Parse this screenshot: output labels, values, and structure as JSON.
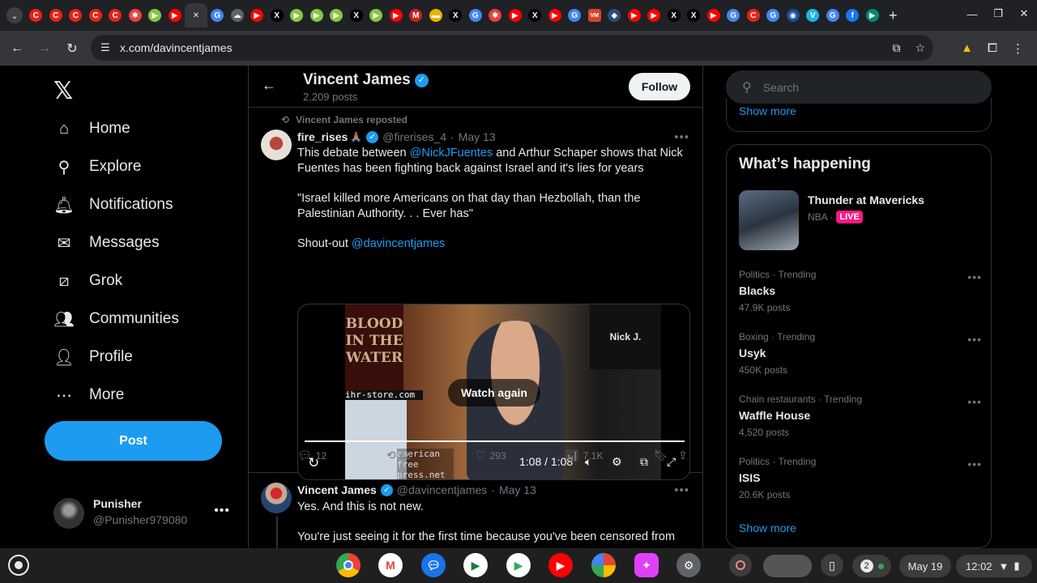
{
  "browser": {
    "url": "x.com/davincentjames",
    "tabs": [
      {
        "icon": "youtube-icon",
        "color": "#e62117",
        "glyph": "C"
      },
      {
        "icon": "youtube-icon",
        "color": "#e62117",
        "glyph": "C"
      },
      {
        "icon": "youtube-icon",
        "color": "#e62117",
        "glyph": "C"
      },
      {
        "icon": "youtube-icon",
        "color": "#e62117",
        "glyph": "C"
      },
      {
        "icon": "youtube-icon",
        "color": "#e62117",
        "glyph": "C"
      },
      {
        "icon": "app-icon",
        "color": "#e8403a",
        "glyph": "✱"
      },
      {
        "icon": "rumble-icon",
        "color": "#85c742",
        "glyph": "▶"
      },
      {
        "icon": "youtube-icon",
        "color": "#ff0000",
        "glyph": "▶"
      },
      {
        "icon": "close-icon",
        "color": "#35363a",
        "glyph": "✕",
        "active": true
      },
      {
        "icon": "google-icon",
        "color": "#4285f4",
        "glyph": "G"
      },
      {
        "icon": "cloud-icon",
        "color": "#5f6368",
        "glyph": "☁"
      },
      {
        "icon": "youtube-icon",
        "color": "#ff0000",
        "glyph": "▶"
      },
      {
        "icon": "x-icon",
        "color": "#000000",
        "glyph": "X"
      },
      {
        "icon": "rumble-icon",
        "color": "#85c742",
        "glyph": "▶"
      },
      {
        "icon": "rumble-icon",
        "color": "#85c742",
        "glyph": "▶"
      },
      {
        "icon": "rumble-icon",
        "color": "#85c742",
        "glyph": "▶"
      },
      {
        "icon": "x-icon",
        "color": "#000000",
        "glyph": "X"
      },
      {
        "icon": "rumble-icon",
        "color": "#85c742",
        "glyph": "▶"
      },
      {
        "icon": "youtube-icon",
        "color": "#ff0000",
        "glyph": "▶"
      },
      {
        "icon": "gmail-icon",
        "color": "#c5221f",
        "glyph": "M"
      },
      {
        "icon": "flag-icon",
        "color": "#e8b400",
        "glyph": "▬"
      },
      {
        "icon": "x-icon",
        "color": "#000000",
        "glyph": "X"
      },
      {
        "icon": "google-icon",
        "color": "#4285f4",
        "glyph": "G"
      },
      {
        "icon": "app-icon",
        "color": "#e8403a",
        "glyph": "✱"
      },
      {
        "icon": "youtube-icon",
        "color": "#ff0000",
        "glyph": "▶"
      },
      {
        "icon": "x-icon",
        "color": "#000000",
        "glyph": "X"
      },
      {
        "icon": "youtube-icon",
        "color": "#ff0000",
        "glyph": "▶"
      },
      {
        "icon": "google-icon",
        "color": "#4285f4",
        "glyph": "G"
      },
      {
        "icon": "vm-icon",
        "color": "#d2462a",
        "glyph": "VM"
      },
      {
        "icon": "site-icon",
        "color": "#2b4c7e",
        "glyph": "◆"
      },
      {
        "icon": "youtube-icon",
        "color": "#ff0000",
        "glyph": "▶"
      },
      {
        "icon": "youtube-icon",
        "color": "#ff0000",
        "glyph": "▶"
      },
      {
        "icon": "x-icon",
        "color": "#000000",
        "glyph": "X"
      },
      {
        "icon": "x-icon",
        "color": "#000000",
        "glyph": "X"
      },
      {
        "icon": "youtube-icon",
        "color": "#ff0000",
        "glyph": "▶"
      },
      {
        "icon": "google-icon",
        "color": "#4285f4",
        "glyph": "G"
      },
      {
        "icon": "youtube-icon",
        "color": "#e62117",
        "glyph": "C"
      },
      {
        "icon": "google-icon",
        "color": "#4285f4",
        "glyph": "G"
      },
      {
        "icon": "site-icon",
        "color": "#1a4d9c",
        "glyph": "◉"
      },
      {
        "icon": "vimeo-icon",
        "color": "#1ab7ea",
        "glyph": "V"
      },
      {
        "icon": "google-icon",
        "color": "#4285f4",
        "glyph": "G"
      },
      {
        "icon": "facebook-icon",
        "color": "#1877f2",
        "glyph": "f"
      },
      {
        "icon": "meet-icon",
        "color": "#00897b",
        "glyph": "▶"
      }
    ]
  },
  "nav": {
    "items": [
      {
        "label": "Home",
        "icon": "home-icon",
        "glyph": "⌂"
      },
      {
        "label": "Explore",
        "icon": "search-icon",
        "glyph": "⚲"
      },
      {
        "label": "Notifications",
        "icon": "bell-icon",
        "glyph": "🔔︎"
      },
      {
        "label": "Messages",
        "icon": "mail-icon",
        "glyph": "✉"
      },
      {
        "label": "Grok",
        "icon": "grok-icon",
        "glyph": "⧄"
      },
      {
        "label": "Communities",
        "icon": "communities-icon",
        "glyph": "👥︎"
      },
      {
        "label": "Profile",
        "icon": "person-icon",
        "glyph": "👤︎"
      },
      {
        "label": "More",
        "icon": "more-icon",
        "glyph": "⋯"
      }
    ],
    "post_label": "Post",
    "account": {
      "name": "Punisher",
      "handle": "@Punisher979080"
    }
  },
  "profile": {
    "title": "Vincent James",
    "post_count": "2,209 posts",
    "follow_label": "Follow"
  },
  "tweet1": {
    "repost_label": "Vincent James reposted",
    "name": "fire_rises",
    "emoji": "🙏🏽",
    "handle": "@firerises_4",
    "date": "May 13",
    "text_pre": "This debate between ",
    "mention": "@NickJFuentes",
    "text_post": " and Arthur Schaper shows that Nick Fuentes has been fighting back against Israel and it's lies for years",
    "quote": "\"Israel killed more Americans on that day than Hezbollah, than the Palestinian Authority. . . Ever has\"",
    "shoutout_pre": "Shout-out ",
    "shoutout_link": "@davincentjames",
    "video": {
      "book_title": "BLOOD IN THE WATER",
      "nick_label": "Nick J.",
      "watermark": "ihr-store.com",
      "overlay": "american free press.net",
      "watch_again": "Watch again",
      "time": "1:08 / 1:08"
    },
    "stats": {
      "replies": "12",
      "reposts": "63",
      "likes": "293",
      "views": "7.1K"
    }
  },
  "tweet2": {
    "name": "Vincent James",
    "handle": "@davincentjames",
    "date": "May 13",
    "line1": "Yes. And this is not new.",
    "line2": "You're just seeing it for the first time because you've been censored from"
  },
  "sidebar": {
    "search_placeholder": "Search",
    "show_more": "Show more",
    "whats_happening": "What’s happening",
    "live": {
      "title": "Thunder at Mavericks",
      "category": "NBA ·",
      "badge": "LIVE"
    },
    "trends": [
      {
        "category": "Politics · Trending",
        "name": "Blacks",
        "count": "47.9K posts"
      },
      {
        "category": "Boxing · Trending",
        "name": "Usyk",
        "count": "450K posts"
      },
      {
        "category": "Chain restaurants · Trending",
        "name": "Waffle House",
        "count": "4,520 posts"
      },
      {
        "category": "Politics · Trending",
        "name": "ISIS",
        "count": "20.6K posts"
      }
    ],
    "show_more_bottom": "Show more"
  },
  "shelf": {
    "date": "May 19",
    "time": "12:02",
    "notif_count": "2"
  }
}
